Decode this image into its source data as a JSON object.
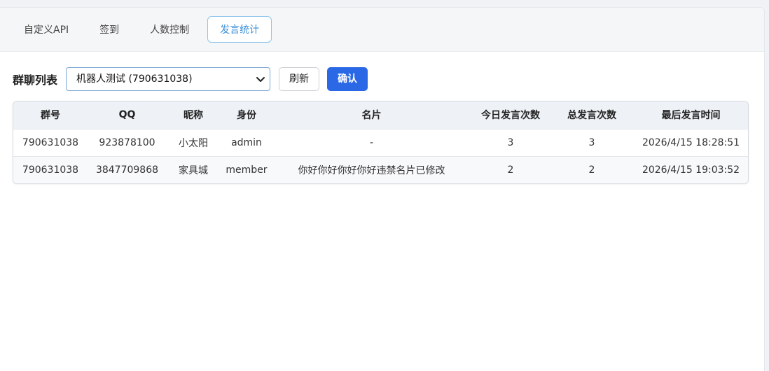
{
  "tabs": [
    {
      "label": "自定义API",
      "active": false
    },
    {
      "label": "签到",
      "active": false
    },
    {
      "label": "人数控制",
      "active": false
    },
    {
      "label": "发言统计",
      "active": true
    }
  ],
  "toolbar": {
    "label": "群聊列表",
    "selected_group": "机器人测试 (790631038)",
    "refresh_label": "刷新",
    "confirm_label": "确认"
  },
  "table": {
    "headers": [
      "群号",
      "QQ",
      "昵称",
      "身份",
      "名片",
      "今日发言次数",
      "总发言次数",
      "最后发言时间"
    ],
    "rows": [
      [
        "790631038",
        "923878100",
        "小太阳",
        "admin",
        "-",
        "3",
        "3",
        "2026/4/15 18:28:51"
      ],
      [
        "790631038",
        "3847709868",
        "家具城",
        "member",
        "你好你好你好你好违禁名片已修改",
        "2",
        "2",
        "2026/4/15 19:03:52"
      ]
    ]
  },
  "colors": {
    "accent": "#2b68e6",
    "active_tab_border": "#8ec5ec",
    "active_tab_text": "#3b8fd8",
    "header_bg": "#eef1f6"
  },
  "icons": {
    "select_caret": "chevron-down-icon"
  }
}
